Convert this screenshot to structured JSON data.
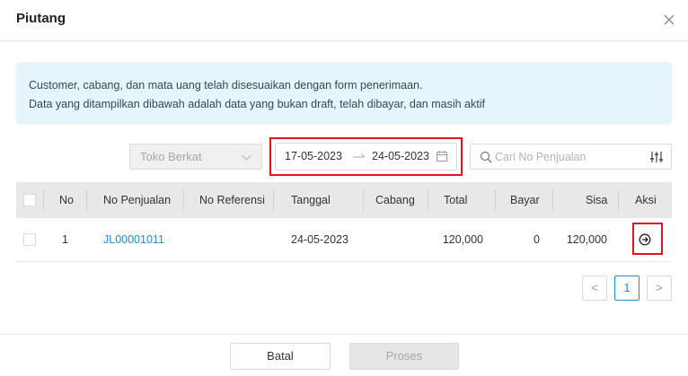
{
  "modal": {
    "title": "Piutang"
  },
  "info": {
    "line1": "Customer, cabang, dan mata uang telah disesuaikan dengan form penerimaan.",
    "line2": "Data yang ditampilkan dibawah adalah data yang bukan draft, telah dibayar, dan masih aktif"
  },
  "filters": {
    "branch_placeholder": "Toko Berkat",
    "date_start": "17-05-2023",
    "date_end": "24-05-2023",
    "search_placeholder": "Cari No Penjualan"
  },
  "table": {
    "headers": {
      "no": "No",
      "no_penjualan": "No Penjualan",
      "no_referensi": "No Referensi",
      "tanggal": "Tanggal",
      "cabang": "Cabang",
      "total": "Total",
      "bayar": "Bayar",
      "sisa": "Sisa",
      "aksi": "Aksi"
    },
    "rows": [
      {
        "no": "1",
        "no_penjualan": "JL00001011",
        "no_referensi": "",
        "tanggal": "24-05-2023",
        "cabang": "",
        "total": "120,000",
        "bayar": "0",
        "sisa": "120,000"
      }
    ]
  },
  "pagination": {
    "prev": "<",
    "current": "1",
    "next": ">"
  },
  "footer": {
    "cancel": "Batal",
    "process": "Proses"
  },
  "colors": {
    "highlight": "#e0141e",
    "link": "#1a8fd8",
    "info_bg": "#e6f4fb"
  }
}
